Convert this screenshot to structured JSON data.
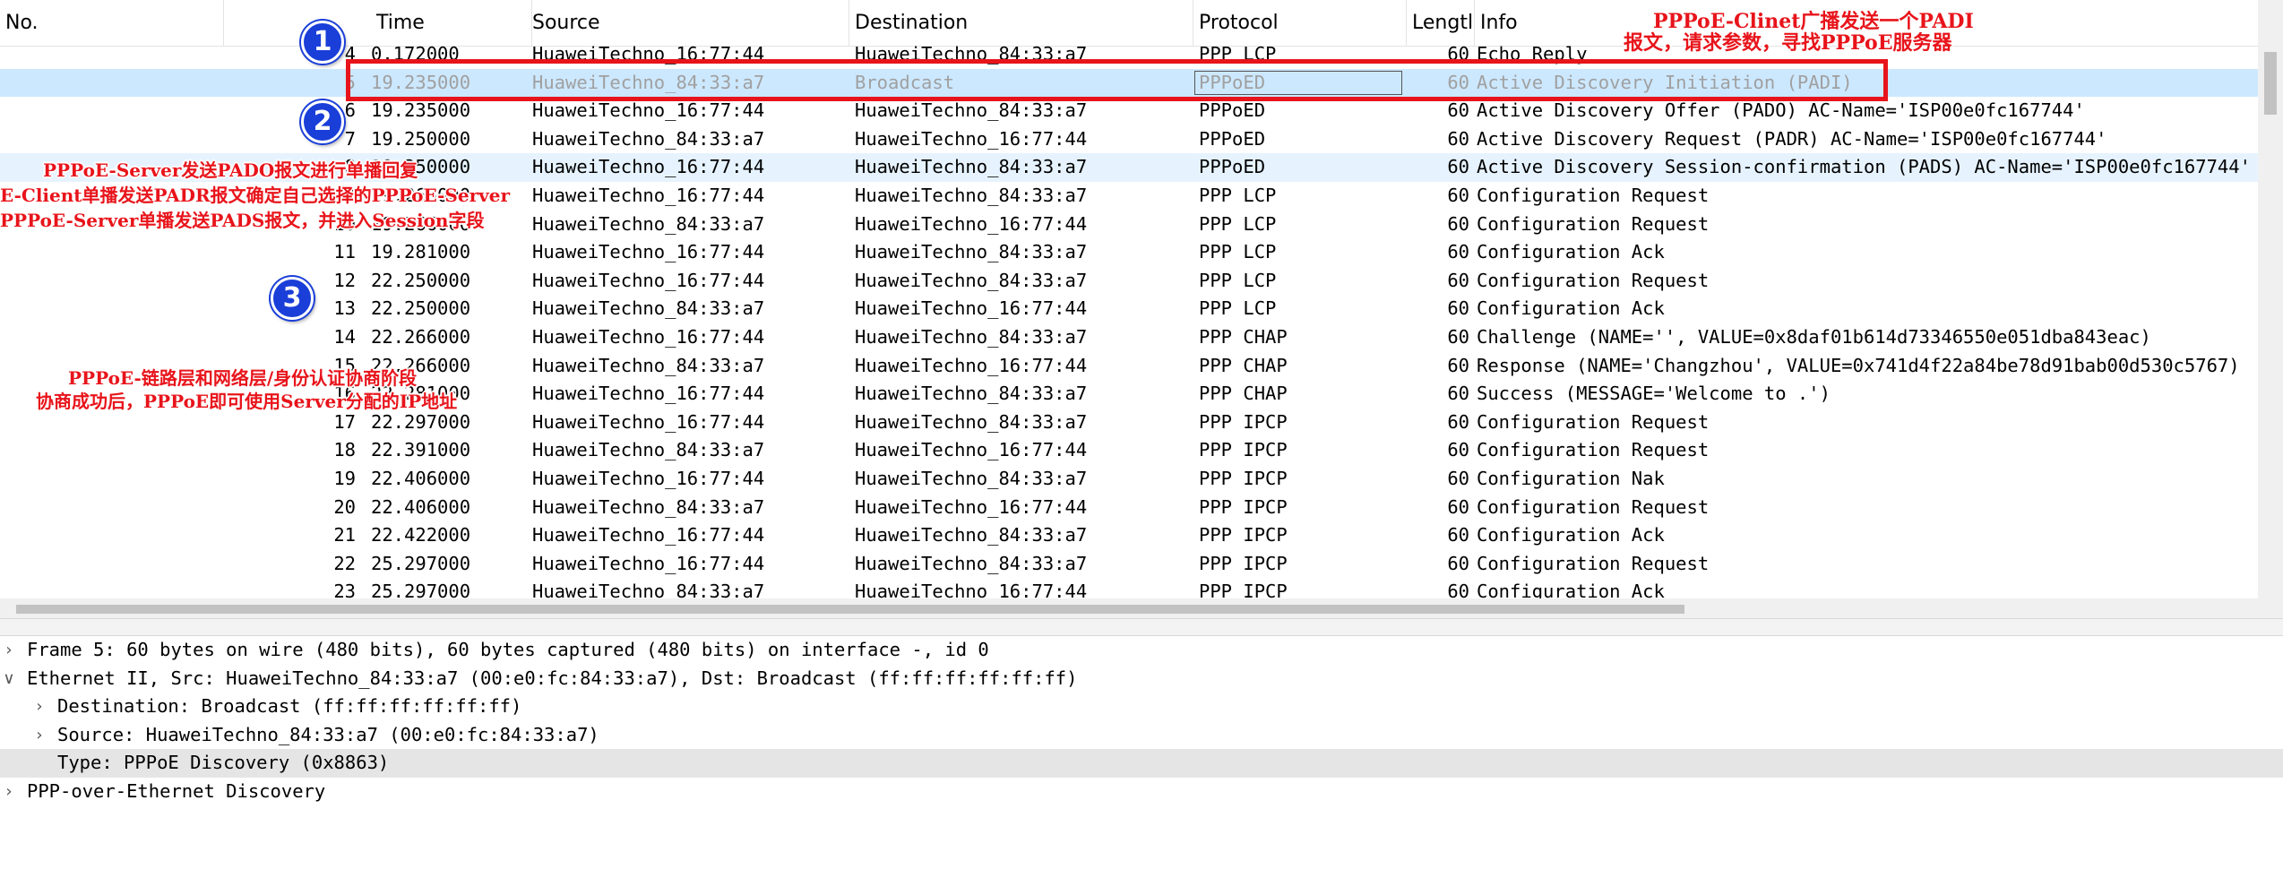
{
  "columns": {
    "no": "No.",
    "time": "Time",
    "source": "Source",
    "destination": "Destination",
    "protocol": "Protocol",
    "length": "Lengtl",
    "info": "Info"
  },
  "packets": [
    {
      "no": "4",
      "time": "0.172000",
      "source": "HuaweiTechno_16:77:44",
      "destination": "HuaweiTechno_84:33:a7",
      "protocol": "PPP LCP",
      "length": "60",
      "info": "Echo Reply"
    },
    {
      "no": "5",
      "time": "19.235000",
      "source": "HuaweiTechno_84:33:a7",
      "destination": "Broadcast",
      "protocol": "PPPoED",
      "length": "60",
      "info": "Active Discovery Initiation (PADI)"
    },
    {
      "no": "6",
      "time": "19.235000",
      "source": "HuaweiTechno_16:77:44",
      "destination": "HuaweiTechno_84:33:a7",
      "protocol": "PPPoED",
      "length": "60",
      "info": "Active Discovery Offer (PADO) AC-Name='ISP00e0fc167744'"
    },
    {
      "no": "7",
      "time": "19.250000",
      "source": "HuaweiTechno_84:33:a7",
      "destination": "HuaweiTechno_16:77:44",
      "protocol": "PPPoED",
      "length": "60",
      "info": "Active Discovery Request (PADR) AC-Name='ISP00e0fc167744'"
    },
    {
      "no": "8",
      "time": "19.250000",
      "source": "HuaweiTechno_16:77:44",
      "destination": "HuaweiTechno_84:33:a7",
      "protocol": "PPPoED",
      "length": "60",
      "info": "Active Discovery Session-confirmation (PADS) AC-Name='ISP00e0fc167744'"
    },
    {
      "no": "9",
      "time": "19.266000",
      "source": "HuaweiTechno_16:77:44",
      "destination": "HuaweiTechno_84:33:a7",
      "protocol": "PPP LCP",
      "length": "60",
      "info": "Configuration Request"
    },
    {
      "no": "10",
      "time": "19.266000",
      "source": "HuaweiTechno_84:33:a7",
      "destination": "HuaweiTechno_16:77:44",
      "protocol": "PPP LCP",
      "length": "60",
      "info": "Configuration Request"
    },
    {
      "no": "11",
      "time": "19.281000",
      "source": "HuaweiTechno_16:77:44",
      "destination": "HuaweiTechno_84:33:a7",
      "protocol": "PPP LCP",
      "length": "60",
      "info": "Configuration Ack"
    },
    {
      "no": "12",
      "time": "22.250000",
      "source": "HuaweiTechno_16:77:44",
      "destination": "HuaweiTechno_84:33:a7",
      "protocol": "PPP LCP",
      "length": "60",
      "info": "Configuration Request"
    },
    {
      "no": "13",
      "time": "22.250000",
      "source": "HuaweiTechno_84:33:a7",
      "destination": "HuaweiTechno_16:77:44",
      "protocol": "PPP LCP",
      "length": "60",
      "info": "Configuration Ack"
    },
    {
      "no": "14",
      "time": "22.266000",
      "source": "HuaweiTechno_16:77:44",
      "destination": "HuaweiTechno_84:33:a7",
      "protocol": "PPP CHAP",
      "length": "60",
      "info": "Challenge (NAME='', VALUE=0x8daf01b614d73346550e051dba843eac)"
    },
    {
      "no": "15",
      "time": "22.266000",
      "source": "HuaweiTechno_84:33:a7",
      "destination": "HuaweiTechno_16:77:44",
      "protocol": "PPP CHAP",
      "length": "60",
      "info": "Response (NAME='Changzhou', VALUE=0x741d4f22a84be78d91bab00d530c5767)"
    },
    {
      "no": "16",
      "time": "22.281000",
      "source": "HuaweiTechno_16:77:44",
      "destination": "HuaweiTechno_84:33:a7",
      "protocol": "PPP CHAP",
      "length": "60",
      "info": "Success (MESSAGE='Welcome to .')"
    },
    {
      "no": "17",
      "time": "22.297000",
      "source": "HuaweiTechno_16:77:44",
      "destination": "HuaweiTechno_84:33:a7",
      "protocol": "PPP IPCP",
      "length": "60",
      "info": "Configuration Request"
    },
    {
      "no": "18",
      "time": "22.391000",
      "source": "HuaweiTechno_84:33:a7",
      "destination": "HuaweiTechno_16:77:44",
      "protocol": "PPP IPCP",
      "length": "60",
      "info": "Configuration Request"
    },
    {
      "no": "19",
      "time": "22.406000",
      "source": "HuaweiTechno_16:77:44",
      "destination": "HuaweiTechno_84:33:a7",
      "protocol": "PPP IPCP",
      "length": "60",
      "info": "Configuration Nak"
    },
    {
      "no": "20",
      "time": "22.406000",
      "source": "HuaweiTechno_84:33:a7",
      "destination": "HuaweiTechno_16:77:44",
      "protocol": "PPP IPCP",
      "length": "60",
      "info": "Configuration Request"
    },
    {
      "no": "21",
      "time": "22.422000",
      "source": "HuaweiTechno_16:77:44",
      "destination": "HuaweiTechno_84:33:a7",
      "protocol": "PPP IPCP",
      "length": "60",
      "info": "Configuration Ack"
    },
    {
      "no": "22",
      "time": "25.297000",
      "source": "HuaweiTechno_16:77:44",
      "destination": "HuaweiTechno_84:33:a7",
      "protocol": "PPP IPCP",
      "length": "60",
      "info": "Configuration Request"
    },
    {
      "no": "23",
      "time": "25.297000",
      "source": "HuaweiTechno_84:33:a7",
      "destination": "HuaweiTechno_16:77:44",
      "protocol": "PPP IPCP",
      "length": "60",
      "info": "Configuration Ack"
    }
  ],
  "details": {
    "frame": "Frame 5: 60 bytes on wire (480 bits), 60 bytes captured (480 bits) on interface -, id 0",
    "ethernet": "Ethernet II, Src: HuaweiTechno_84:33:a7 (00:e0:fc:84:33:a7), Dst: Broadcast (ff:ff:ff:ff:ff:ff)",
    "destination": "Destination: Broadcast (ff:ff:ff:ff:ff:ff)",
    "source": "Source: HuaweiTechno_84:33:a7 (00:e0:fc:84:33:a7)",
    "type": "Type: PPPoE Discovery (0x8863)",
    "pppoe": "PPP-over-Ethernet Discovery"
  },
  "annotations": {
    "badge1": "1",
    "badge2": "2",
    "badge3": "3",
    "padi_note_1": "PPPoE-Clinet广播发送一个PADI",
    "padi_note_2": "报文，请求参数，寻找PPPoE服务器",
    "pado_note": "PPPoE-Server发送PADO报文进行单播回复",
    "padr_note": "E-Client单播发送PADR报文确定自己选择的PPPoE-Server",
    "pads_note": "PPPoE-Server单播发送PADS报文，并进入Session字段",
    "session_note_1": "PPPoE-链路层和网络层/身份认证协商阶段",
    "session_note_2": "协商成功后，PPPoE即可使用Server分配的IP地址"
  },
  "colors": {
    "selected_row": "#cce8ff",
    "annotation_red": "#e8141b",
    "badge_blue": "#1a3ed8"
  }
}
